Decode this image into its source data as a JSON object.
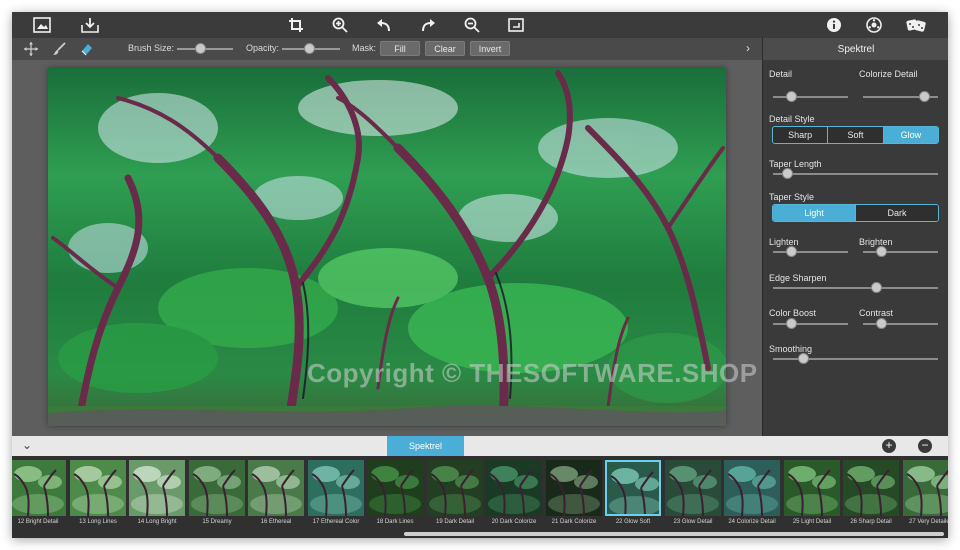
{
  "toolbar": {
    "left_icons": [
      "image-open-icon",
      "save-download-icon"
    ],
    "center_icons": [
      "crop-icon",
      "zoom-in-icon",
      "undo-icon",
      "redo-icon",
      "zoom-out-icon",
      "fit-screen-icon"
    ],
    "right_icons": [
      "info-icon",
      "settings-wheel-icon",
      "dice-randomize-icon"
    ]
  },
  "options": {
    "tools": [
      "move-tool-icon",
      "brush-tool-icon",
      "eraser-tool-icon"
    ],
    "brush_size_label": "Brush Size:",
    "opacity_label": "Opacity:",
    "mask_label": "Mask:",
    "fill": "Fill",
    "clear": "Clear",
    "invert": "Invert",
    "brush_size_level": 0.4,
    "opacity_level": 0.45
  },
  "canvas": {
    "watermark": "Copyright © THESOFTWARE.SHOP"
  },
  "panel": {
    "title": "Spektrel",
    "detail": {
      "label": "Detail",
      "level": 0.25
    },
    "colorize_detail": {
      "label": "Colorize Detail",
      "level": 0.85
    },
    "detail_style": {
      "label": "Detail Style",
      "options": [
        "Sharp",
        "Soft",
        "Glow"
      ],
      "selected": "Glow"
    },
    "taper_length": {
      "label": "Taper Length",
      "level": 0.08
    },
    "taper_style": {
      "label": "Taper Style",
      "options": [
        "Light",
        "Dark"
      ],
      "selected": "Light"
    },
    "lighten": {
      "label": "Lighten",
      "level": 0.25
    },
    "brighten": {
      "label": "Brighten",
      "level": 0.25
    },
    "edge_sharpen": {
      "label": "Edge Sharpen",
      "level": 0.62
    },
    "color_boost": {
      "label": "Color Boost",
      "level": 0.25
    },
    "contrast": {
      "label": "Contrast",
      "level": 0.25
    },
    "smoothing": {
      "label": "Smoothing",
      "level": 0.2
    }
  },
  "presets": {
    "active_tab": "Spektrel",
    "items": [
      {
        "label": "12 Bright Detail"
      },
      {
        "label": "13 Long Lines"
      },
      {
        "label": "14 Long Bright"
      },
      {
        "label": "15 Dreamy"
      },
      {
        "label": "16 Ethereal"
      },
      {
        "label": "17 Ethereal Color"
      },
      {
        "label": "18 Dark Lines"
      },
      {
        "label": "19 Dark Detail"
      },
      {
        "label": "20 Dark Colorize"
      },
      {
        "label": "21 Dark Colorize"
      },
      {
        "label": "22 Glow Soft"
      },
      {
        "label": "23 Glow Detail"
      },
      {
        "label": "24 Colorize Detail"
      },
      {
        "label": "25 Light Detail"
      },
      {
        "label": "26 Sharp Detail"
      },
      {
        "label": "27 Very Detailed"
      }
    ],
    "selected_index": 10
  },
  "colors": {
    "accent": "#4aaed6",
    "toolbar_bg": "#3b3b3b",
    "panel_bg": "#3a3a3a"
  }
}
